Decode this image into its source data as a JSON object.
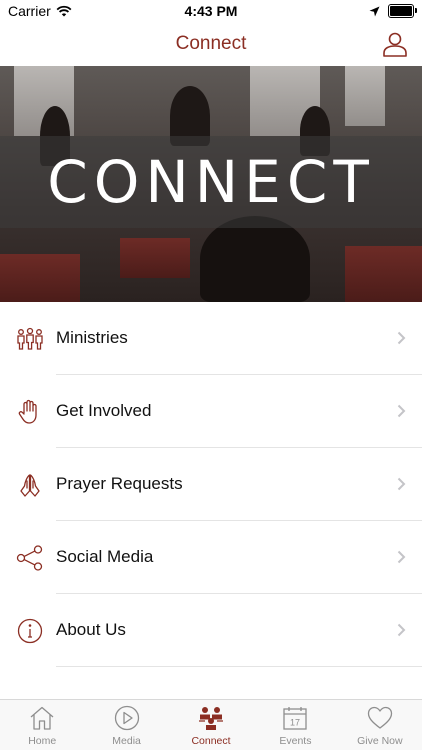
{
  "status_bar": {
    "carrier": "Carrier",
    "time": "4:43 PM",
    "icons": [
      "wifi-icon",
      "location-arrow-icon",
      "battery-icon"
    ]
  },
  "nav": {
    "title": "Connect",
    "profile_icon": "person-outline-icon"
  },
  "hero": {
    "text": "CONNECT"
  },
  "menu": {
    "items": [
      {
        "label": "Ministries",
        "icon": "people-group-icon"
      },
      {
        "label": "Get Involved",
        "icon": "raised-hand-icon"
      },
      {
        "label": "Prayer Requests",
        "icon": "praying-hands-icon"
      },
      {
        "label": "Social Media",
        "icon": "share-nodes-icon"
      },
      {
        "label": "About Us",
        "icon": "info-circle-icon"
      }
    ]
  },
  "tabs": [
    {
      "label": "Home",
      "icon": "home-icon",
      "active": false
    },
    {
      "label": "Media",
      "icon": "play-circle-icon",
      "active": false
    },
    {
      "label": "Connect",
      "icon": "connect-people-icon",
      "active": true
    },
    {
      "label": "Events",
      "icon": "calendar-icon",
      "day": "17",
      "active": false
    },
    {
      "label": "Give Now",
      "icon": "heart-icon",
      "active": false
    }
  ],
  "colors": {
    "accent": "#8b2e23",
    "inactive_tab": "#8e8e8e",
    "divider": "#e4e4e4"
  }
}
